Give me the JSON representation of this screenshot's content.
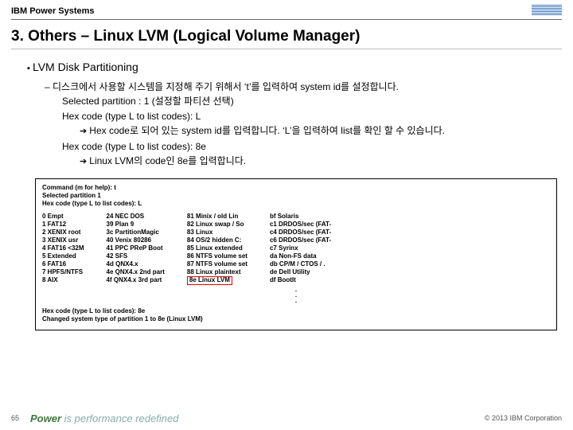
{
  "header": {
    "brand": "IBM Power Systems",
    "logo_alt": "IBM"
  },
  "title": "3. Others – Linux LVM (Logical Volume Manager)",
  "section": {
    "h2": "LVM Disk Partitioning",
    "line1": "디스크에서 사용할 시스템을 지정해 주기 위해서 ‘t’를 입력하여 system id를 설정합니다.",
    "line2": "Selected partition : 1 (설정할 파티션 선택)",
    "line3": "Hex code (type L to list codes): L",
    "line4": "Hex code로 되어 있는 system id를 입력합니다. ‘L’을 입력하여 list를 확인 할 수 있습니다.",
    "line5": "Hex code (type L to list codes): 8e",
    "line6": "Linux LVM의 code인 8e를 입력합니다."
  },
  "terminal": {
    "top1": "Command (m for help): t",
    "top2": "Selected partition 1",
    "top3": "Hex code (type L to list codes): L",
    "cols": [
      [
        "0  Empt",
        "1  FAT12",
        "2  XENIX root",
        "3  XENIX usr",
        "4  FAT16 <32M",
        "5  Extended",
        "6  FAT16",
        "7  HPFS/NTFS",
        "8  AIX"
      ],
      [
        "24  NEC DOS",
        "39  Plan 9",
        "3c  PartitionMagic",
        "40  Venix 80286",
        "41  PPC PReP Boot",
        "42  SFS",
        "4d  QNX4.x",
        "4e  QNX4.x 2nd part",
        "4f  QNX4.x 3rd part"
      ],
      [
        "81  Minix / old Lin",
        "82  Linux swap / So",
        "83  Linux",
        "84  OS/2 hidden C:",
        "85  Linux extended",
        "86  NTFS volume set",
        "87  NTFS volume set",
        "88  Linux plaintext",
        "8e  Linux LVM"
      ],
      [
        "bf  Solaris",
        "c1  DRDOS/sec (FAT-",
        "c4  DRDOS/sec (FAT-",
        "c6  DRDOS/sec (FAT-",
        "c7  Syrinx",
        "da  Non-FS data",
        "db  CP/M / CTOS / .",
        "de  Dell Utility",
        "df  BootIt"
      ]
    ],
    "highlight_col": 2,
    "highlight_row": 8,
    "bot1": "Hex code (type L to list codes): 8e",
    "bot2": "Changed system type of partition 1 to 8e (Linux LVM)"
  },
  "footer": {
    "page": "65",
    "slogan_a": "Power",
    "slogan_b": " is performance redefined",
    "copyright": "© 2013 IBM Corporation"
  }
}
